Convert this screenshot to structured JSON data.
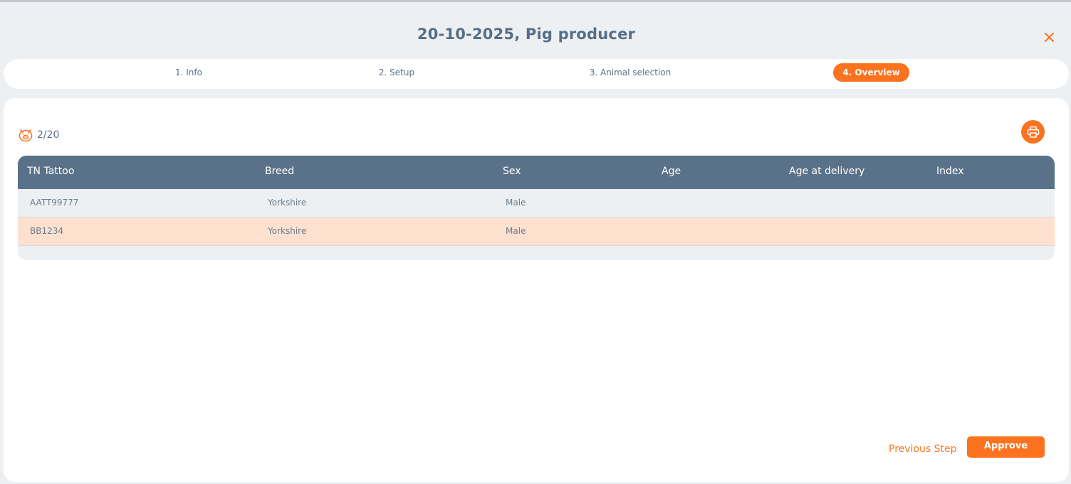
{
  "dialog": {
    "title": "20-10-2025, Pig producer"
  },
  "steps": [
    {
      "label": "1. Info",
      "active": false
    },
    {
      "label": "2. Setup",
      "active": false
    },
    {
      "label": "3. Animal selection",
      "active": false
    },
    {
      "label": "4. Overview",
      "active": true
    }
  ],
  "overview": {
    "counter": "2/20",
    "counter_icon": "pig-icon",
    "print_icon": "printer-icon"
  },
  "table": {
    "columns": [
      "TN Tattoo",
      "Breed",
      "Sex",
      "Age",
      "Age at delivery",
      "Index"
    ],
    "rows": [
      {
        "tattoo": "AATT99777",
        "breed": "Yorkshire",
        "sex": "Male",
        "age": "",
        "age_at_delivery": "",
        "index": "",
        "highlighted": false
      },
      {
        "tattoo": "BB1234",
        "breed": "Yorkshire",
        "sex": "Male",
        "age": "",
        "age_at_delivery": "",
        "index": "",
        "highlighted": true
      }
    ]
  },
  "footer": {
    "previous_label": "Previous Step",
    "approve_label": "Approve"
  },
  "colors": {
    "accent": "#fb731f",
    "header": "#5a7289",
    "highlight_row": "#fde0ce",
    "text": "#5a7188"
  }
}
